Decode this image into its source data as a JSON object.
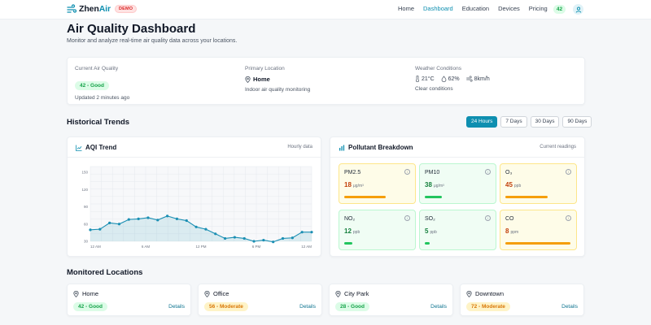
{
  "nav": {
    "brand_prefix": "Zhen",
    "brand_accent": "Air",
    "badge": "DEMO",
    "links": [
      "Home",
      "Dashboard",
      "Education",
      "Devices",
      "Pricing"
    ],
    "active_link": "Dashboard",
    "aqi": "42",
    "user_icon": "user-icon"
  },
  "page": {
    "title": "Air Quality Dashboard",
    "subtitle": "Monitor and analyze real-time air quality data across your locations."
  },
  "summary": {
    "current": {
      "label": "Current Air Quality",
      "value": "42",
      "status": "Good",
      "updated": "Updated 2 minutes ago"
    },
    "location": {
      "label": "Primary Location",
      "name": "Home",
      "desc": "Indoor air quality monitoring"
    },
    "weather": {
      "label": "Weather Conditions",
      "temp": "21°C",
      "humidity": "62%",
      "wind": "8km/h",
      "desc": "Clear conditions"
    }
  },
  "historical": {
    "title": "Historical Trends",
    "ranges": [
      "24 Hours",
      "7 Days",
      "30 Days",
      "90 Days"
    ],
    "active_range": "24 Hours"
  },
  "trend": {
    "title": "AQI Trend",
    "meta": "Hourly data"
  },
  "chart_data": {
    "type": "area",
    "title": "AQI Trend",
    "x_ticks": [
      "12 AM",
      "6 AM",
      "12 PM",
      "6 PM",
      "12 AM"
    ],
    "y_ticks": [
      30,
      60,
      90,
      120,
      150
    ],
    "ylim": [
      30,
      160
    ],
    "series": [
      {
        "values": [
          50,
          51,
          62,
          60,
          68,
          69,
          71,
          67,
          74,
          69,
          66,
          55,
          51,
          43,
          35,
          37,
          35,
          30,
          32,
          29,
          35,
          36,
          46,
          46
        ]
      }
    ],
    "grid": true,
    "color": "#1b8fb3"
  },
  "pollutants": {
    "title": "Pollutant Breakdown",
    "meta": "Current readings",
    "items": [
      {
        "name": "PM2.5",
        "value": "18",
        "unit": "μg/m³",
        "level": 0.63,
        "tone": "yellow",
        "bar": "#f59e0b"
      },
      {
        "name": "PM10",
        "value": "38",
        "unit": "μg/m³",
        "level": 0.26,
        "tone": "green",
        "bar": "#22c55e"
      },
      {
        "name": "O₃",
        "value": "45",
        "unit": "ppb",
        "level": 0.64,
        "tone": "yellow",
        "bar": "#f59e0b"
      },
      {
        "name": "NO₂",
        "value": "12",
        "unit": "ppb",
        "level": 0.12,
        "tone": "green",
        "bar": "#22c55e"
      },
      {
        "name": "SO₂",
        "value": "5",
        "unit": "ppb",
        "level": 0.07,
        "tone": "green",
        "bar": "#22c55e"
      },
      {
        "name": "CO",
        "value": "8",
        "unit": "ppm",
        "level": 0.99,
        "tone": "yellow",
        "bar": "#f59e0b"
      }
    ]
  },
  "locations": {
    "title": "Monitored Locations",
    "items": [
      {
        "name": "Home",
        "value": "42",
        "status": "Good",
        "tone": "good",
        "details": "Details"
      },
      {
        "name": "Office",
        "value": "56",
        "status": "Moderate",
        "tone": "moderate",
        "details": "Details"
      },
      {
        "name": "City Park",
        "value": "28",
        "status": "Good",
        "tone": "good",
        "details": "Details"
      },
      {
        "name": "Downtown",
        "value": "72",
        "status": "Moderate",
        "tone": "moderate",
        "details": "Details"
      }
    ]
  }
}
